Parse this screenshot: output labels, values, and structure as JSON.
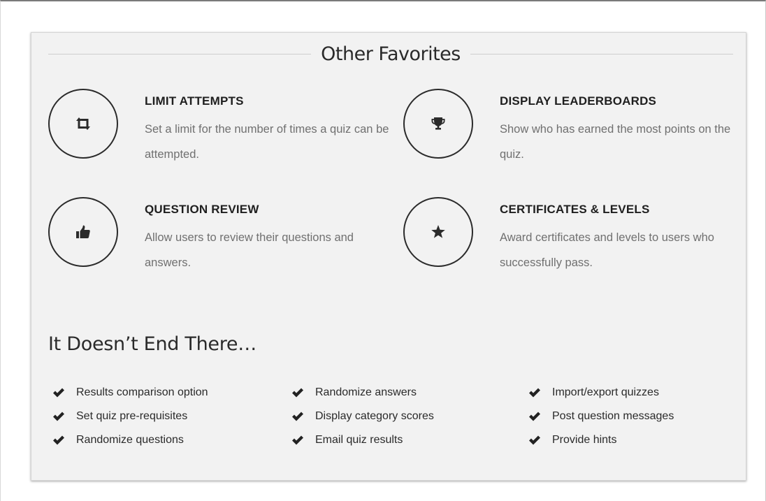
{
  "favorites": {
    "heading": "Other Favorites",
    "items": [
      {
        "icon": "retweet-icon",
        "title": "LIMIT ATTEMPTS",
        "description": "Set a limit for the number of times a quiz can be attempted."
      },
      {
        "icon": "trophy-icon",
        "title": "DISPLAY LEADERBOARDS",
        "description": "Show who has earned the most points on the quiz."
      },
      {
        "icon": "thumbs-up-icon",
        "title": "QUESTION REVIEW",
        "description": "Allow users to review their questions and answers."
      },
      {
        "icon": "star-icon",
        "title": "CERTIFICATES & LEVELS",
        "description": "Award certificates and levels to users who successfully pass."
      }
    ]
  },
  "more": {
    "heading": "It Doesn’t End There…",
    "columns": [
      [
        "Results comparison option",
        "Set quiz pre-requisites",
        "Randomize questions"
      ],
      [
        "Randomize answers",
        "Display category scores",
        "Email quiz results"
      ],
      [
        "Import/export quizzes",
        "Post question messages",
        "Provide hints"
      ]
    ]
  },
  "colors": {
    "panel_background": "#f2f2f2",
    "heading_text": "#2a2a2a",
    "description_text": "#707070",
    "icon_stroke": "#2b2b2b"
  }
}
